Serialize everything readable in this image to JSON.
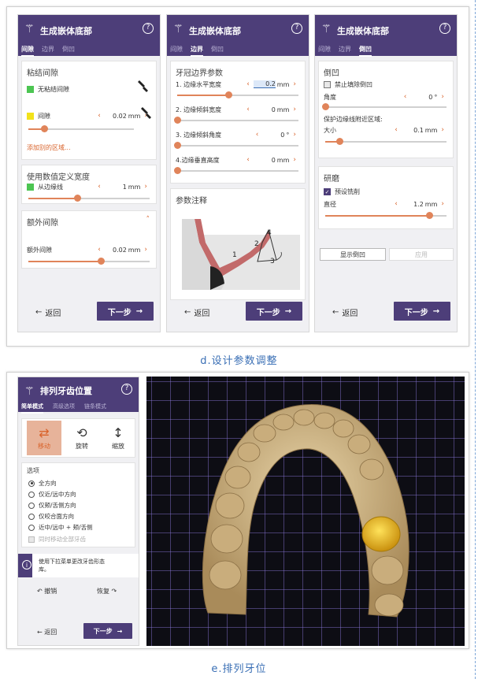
{
  "figure": {
    "caption_top": "d.设计参数调整",
    "caption_bottom": "e.排列牙位"
  },
  "panel_common": {
    "title": "生成嵌体底部",
    "tabs": [
      "间隙",
      "边界",
      "倒凹"
    ],
    "back_label": "返回",
    "next_label": "下一步"
  },
  "panel1": {
    "card1_title": "粘结间隙",
    "no_cement_label": "无粘结间隙",
    "gap_label": "间隙",
    "gap_value": "0.02",
    "gap_unit": "mm",
    "gap_slider": 0.15,
    "add_region_link": "添加别的区域...",
    "card2_title": "使用数值定义宽度",
    "from_margin_label": "从边缘线",
    "from_margin_value": "1",
    "from_margin_unit": "mm",
    "from_margin_slider": 0.4,
    "card3_title": "额外间隙",
    "extra_gap_label": "额外间隙",
    "extra_gap_value": "0.02",
    "extra_gap_unit": "mm",
    "extra_gap_slider": 0.6
  },
  "panel2": {
    "card1_title": "牙冠边界参数",
    "params": [
      {
        "label": "1. 边缘水平宽度",
        "value": "0.2",
        "unit": "mm",
        "slider": 0.42
      },
      {
        "label": "2. 边缘倾斜宽度",
        "value": "0",
        "unit": "mm",
        "slider": 0.0
      },
      {
        "label": "3. 边缘倾斜角度",
        "value": "0",
        "unit": "°",
        "slider": 0.0
      },
      {
        "label": "4.边缘垂直高度",
        "value": "0",
        "unit": "mm",
        "slider": 0.0
      }
    ],
    "card2_title": "参数注释",
    "diagram_labels": [
      "1",
      "2",
      "3",
      "4"
    ]
  },
  "panel3": {
    "card1_title": "倒凹",
    "forbid_fill_label": "禁止填除倒凹",
    "angle_label": "角度",
    "angle_value": "0",
    "angle_unit": "°",
    "angle_slider": 0.0,
    "protect_label": "保护边缘线附近区域:",
    "size_label": "大小",
    "size_value": "0.1",
    "size_unit": "mm",
    "size_slider": 0.12,
    "card2_title": "研磨",
    "drill_label": "预设铣削",
    "diameter_label": "直径",
    "diameter_value": "1.2",
    "diameter_unit": "mm",
    "diameter_slider": 0.86,
    "show_undercut_button": "显示倒凹",
    "apply_button": "应用"
  },
  "panel4": {
    "title": "排列牙齿位置",
    "tabs": [
      "简单模式",
      "高级选项",
      "链条模式"
    ],
    "tools": [
      "移动",
      "旋转",
      "缩放"
    ],
    "options_title": "选项",
    "radio_options": [
      "全方向",
      "仅近/远中方向",
      "仅颊/舌侧方向",
      "仅咬合面方向",
      "近中/远中 + 颊/舌侧"
    ],
    "move_all_label": "同时移动全部牙齿",
    "info_text": "使用下拉菜单更改牙齿形态库。",
    "undo_label": "撤销",
    "redo_label": "恢复",
    "back_label": "返回",
    "next_label": "下一步"
  },
  "colors": {
    "header": "#4d3e79",
    "accent": "#e0845a",
    "tooth": "#d8bf8f",
    "selected_tooth": "#e8b92a"
  }
}
